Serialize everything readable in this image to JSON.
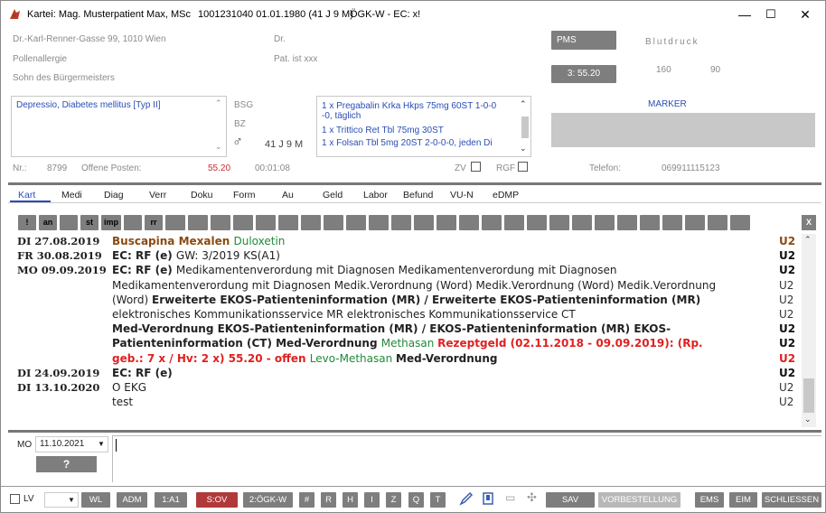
{
  "titlebar": {
    "title": "Kartei: Mag. Musterpatient Max, MSc",
    "patient_id": "1001231040 01.01.1980 (41 J 9 M)",
    "insurance": "ÖGK-W - EC: x!",
    "min": "—",
    "max": "☐",
    "close": "✕"
  },
  "patient": {
    "address": "Dr.-Karl-Renner-Gasse 99, 1010 Wien",
    "allergy": "Pollenallergie",
    "note": "Sohn des Bürgermeisters",
    "title_field": "Dr.",
    "pat_ist": "Pat. ist xxx",
    "diagnoses": "Depressio, Diabetes mellitus [Typ II]",
    "bsg": "BSG",
    "bz": "BZ",
    "age": "41 J 9 M",
    "gender": "♂"
  },
  "medication": [
    "1 x Pregabalin Krka Hkps  75mg 60ST 1-0-0",
    "-0, täglich",
    "1 x Trittico Ret Tbl  75mg 30ST",
    "1 x Folsan Tbl 5mg 20ST 2-0-0-0, jeden Di"
  ],
  "right": {
    "pms": "PMS",
    "time_btn": "3: 55.20",
    "blutdruck": "Blutdruck",
    "bp_sys": "160",
    "bp_dia": "90",
    "marker": "MARKER",
    "telefon_label": "Telefon:",
    "telefon": "069911115123"
  },
  "status": {
    "nr_label": "Nr.:",
    "nr": "8799",
    "offene_label": "Offene Posten:",
    "offene": "55.20",
    "timer": "00:01:08",
    "zv": "ZV",
    "rgf": "RGF"
  },
  "tabs": [
    "Kart",
    "Medi",
    "Diag",
    "Verr",
    "Doku",
    "Form",
    "Au",
    "Geld",
    "Labor",
    "Befund",
    "VU-N",
    "eDMP"
  ],
  "journal_buttons": [
    "!",
    "an",
    "",
    "st",
    "imp",
    "",
    "rr"
  ],
  "journal_close": "X",
  "journal": [
    {
      "date": "DI  27.08.2019",
      "parts": [
        [
          "br",
          "Buscapina  Mexalen "
        ],
        [
          "gr",
          "Duloxetin"
        ]
      ],
      "u": "U2",
      "ucol": "#8a4a10"
    },
    {
      "date": "FR  30.08.2019",
      "parts": [
        [
          "b",
          "EC: RF (e) "
        ],
        [
          "n",
          " GW: 3/2019 KS(A1)"
        ]
      ],
      "u": "U2",
      "ucol": "#111"
    },
    {
      "date": "MO 09.09.2019",
      "parts": [
        [
          "b",
          "EC: RF (e) "
        ],
        [
          "n",
          " Medikamentenverordung mit Diagnosen  Medikamentenverordung mit Diagnosen"
        ]
      ],
      "u": "U2",
      "ucol": "#111"
    },
    {
      "date": "",
      "parts": [
        [
          "n",
          "Medikamentenverordung mit Diagnosen  Medik.Verordnung (Word)  Medik.Verordnung (Word)  Medik.Verordnung"
        ]
      ],
      "u": "U2",
      "ucol": "#333",
      "un": true
    },
    {
      "date": "",
      "parts": [
        [
          "n",
          "(Word)  "
        ],
        [
          "b",
          "Erweiterte EKOS-Patienteninformation (MR) / Erweiterte EKOS-Patienteninformation (MR)"
        ]
      ],
      "u": "U2",
      "ucol": "#333",
      "un": true
    },
    {
      "date": "",
      "parts": [
        [
          "n",
          "elektronisches Kommunikationsservice MR  elektronisches Kommunikationsservice CT"
        ]
      ],
      "u": "U2",
      "ucol": "#333",
      "un": true
    },
    {
      "date": "",
      "parts": [
        [
          "b",
          "Med-Verordnung  EKOS-Patienteninformation (MR) / EKOS-Patienteninformation (MR)  EKOS-"
        ]
      ],
      "u": "U2",
      "ucol": "#111"
    },
    {
      "date": "",
      "parts": [
        [
          "b",
          "Patienteninformation (CT)  Med-Verordnung  "
        ],
        [
          "gr",
          "Methasan  "
        ],
        [
          "rd",
          "Rezeptgeld (02.11.2018 - 09.09.2019): (Rp."
        ]
      ],
      "u": "U2",
      "ucol": "#111"
    },
    {
      "date": "",
      "parts": [
        [
          "rd",
          "geb.: 7 x / Hv: 2 x)   55.20 - offen  "
        ],
        [
          "gr",
          "Levo-Methasan  "
        ],
        [
          "b",
          "Med-Verordnung"
        ]
      ],
      "u": "U2",
      "ucol": "#e02020"
    },
    {
      "date": "DI  24.09.2019",
      "parts": [
        [
          "b",
          "EC: RF (e)"
        ]
      ],
      "u": "U2",
      "ucol": "#111"
    },
    {
      "date": "DI   13.10.2020",
      "parts": [
        [
          "n",
          "O  EKG"
        ]
      ],
      "u": "U2",
      "ucol": "#333",
      "un": true
    },
    {
      "date": "",
      "parts": [
        [
          "n",
          "test"
        ]
      ],
      "u": "U2",
      "ucol": "#333",
      "un": true
    }
  ],
  "entry": {
    "day": "MO",
    "date": "11.10.2021",
    "help": "?"
  },
  "bottom": {
    "lv": "LV",
    "buttons": [
      "WL",
      "ADM",
      "1:A1",
      "S:OV",
      "2:ÖGK-W",
      "#",
      "R",
      "H",
      "I",
      "Z",
      "Q",
      "T"
    ],
    "sav": "SAV",
    "vorbestellung": "VORBESTELLUNG",
    "ems": "EMS",
    "eim": "EIM",
    "schliessen": "SCHLIESSEN"
  }
}
